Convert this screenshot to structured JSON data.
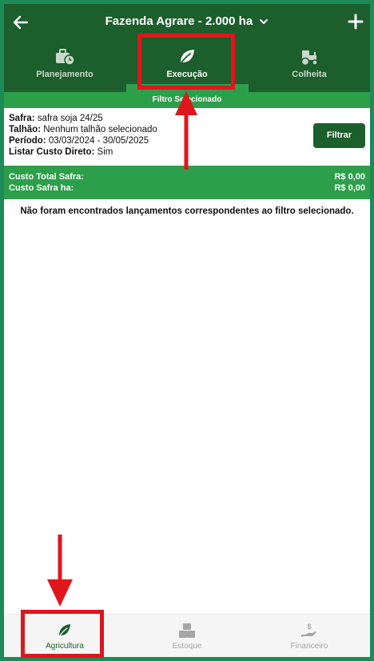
{
  "header": {
    "title": "Fazenda Agrare - 2.000 ha",
    "back_icon": "back-arrow-icon",
    "dropdown_icon": "chevron-down-icon",
    "add_icon": "plus-icon"
  },
  "tabs": [
    {
      "label": "Planejamento",
      "icon": "briefcase-clock-icon",
      "active": false
    },
    {
      "label": "Execução",
      "icon": "leaf-icon",
      "active": true
    },
    {
      "label": "Colheita",
      "icon": "tractor-icon",
      "active": false
    }
  ],
  "filter": {
    "banner": "Filtro Selecionado",
    "safra_label": "Safra:",
    "safra_value": "safra soja 24/25",
    "talhao_label": "Talhão:",
    "talhao_value": "Nenhum talhão selecionado",
    "periodo_label": "Período:",
    "periodo_value": "03/03/2024 - 30/05/2025",
    "custo_label": "Listar Custo Direto:",
    "custo_value": "Sim",
    "button": "Filtrar"
  },
  "costs": {
    "total_label": "Custo Total Safra:",
    "total_value": "R$ 0,00",
    "ha_label": "Custo Safra ha:",
    "ha_value": "R$ 0,00"
  },
  "empty_message": "Não foram encontrados lançamentos correspondentes ao filtro selecionado.",
  "bottom_nav": [
    {
      "label": "Agricultura",
      "icon": "leaf-icon",
      "active": true
    },
    {
      "label": "Estoque",
      "icon": "boxes-icon",
      "active": false
    },
    {
      "label": "Financeiro",
      "icon": "hand-money-icon",
      "active": false
    }
  ],
  "colors": {
    "header_bg": "#1c5e2c",
    "accent_green": "#2d9e4a",
    "frame_border": "#1e8a57",
    "annotation_red": "#e0161d"
  }
}
